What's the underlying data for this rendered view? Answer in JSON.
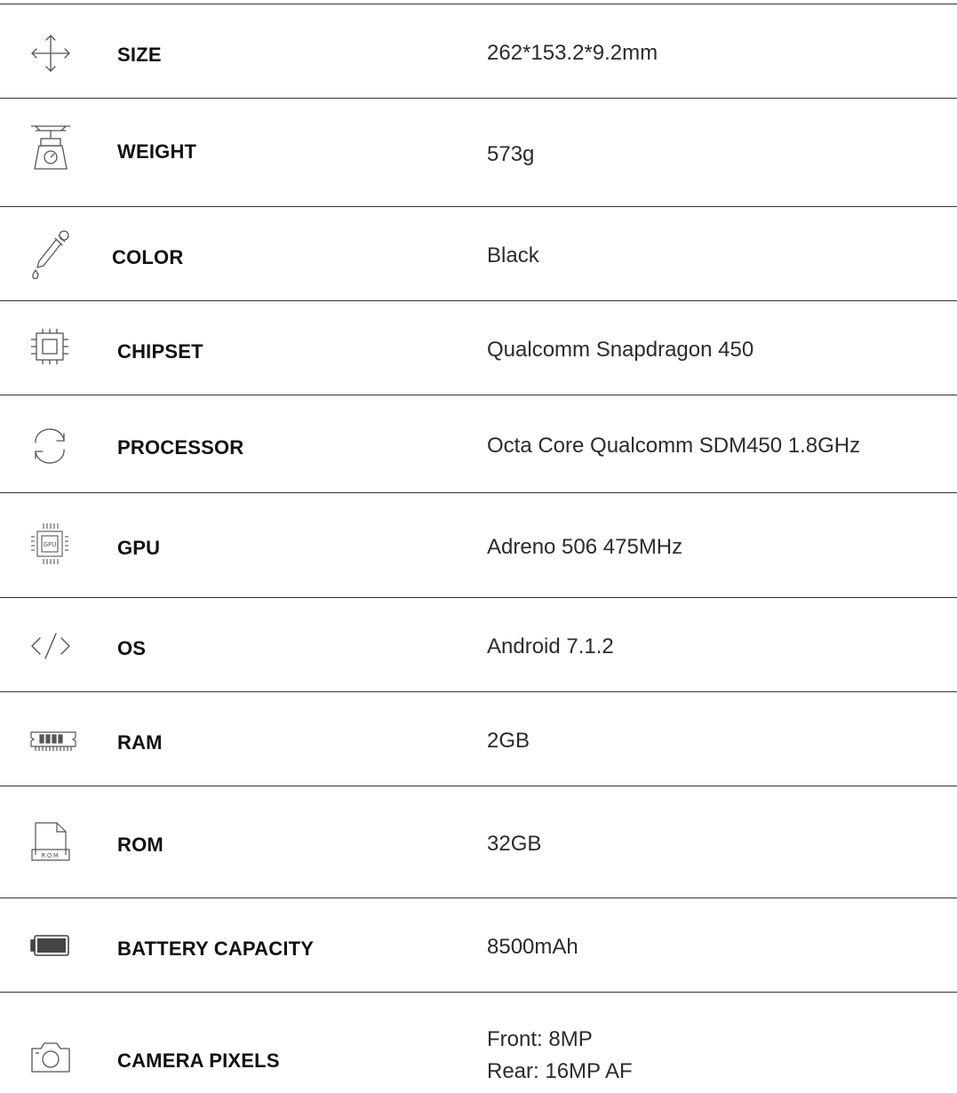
{
  "specs": [
    {
      "icon": "move-arrows-icon",
      "label": "SIZE",
      "value": "262*153.2*9.2mm"
    },
    {
      "icon": "weighing-scale-icon",
      "label": "WEIGHT",
      "value": "573g"
    },
    {
      "icon": "eyedropper-icon",
      "label": "COLOR",
      "value": "Black"
    },
    {
      "icon": "chipset-icon",
      "label": "CHIPSET",
      "value": "Qualcomm Snapdragon 450"
    },
    {
      "icon": "refresh-cycle-icon",
      "label": "PROCESSOR",
      "value": "Octa Core Qualcomm SDM450 1.8GHz"
    },
    {
      "icon": "gpu-chip-icon",
      "label": "GPU",
      "value": "Adreno 506 475MHz",
      "icon_text": "GPU"
    },
    {
      "icon": "code-brackets-icon",
      "label": "OS",
      "value": "Android 7.1.2"
    },
    {
      "icon": "ram-module-icon",
      "label": "RAM",
      "value": "2GB"
    },
    {
      "icon": "rom-file-icon",
      "label": "ROM",
      "value": "32GB",
      "icon_text": "ROM"
    },
    {
      "icon": "battery-icon",
      "label": "BATTERY CAPACITY",
      "value": "8500mAh"
    },
    {
      "icon": "camera-icon",
      "label": "CAMERA PIXELS",
      "value_lines": [
        "Front: 8MP",
        "Rear: 16MP AF"
      ]
    }
  ]
}
